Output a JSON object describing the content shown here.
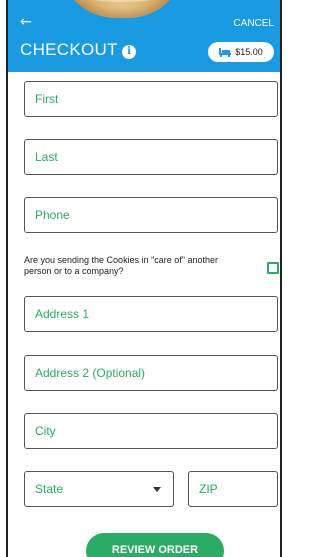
{
  "header": {
    "back_icon": "arrow-left-icon",
    "cancel_label": "CANCEL",
    "title": "CHECKOUT",
    "info_icon": "info-icon",
    "cart_icon": "cart-icon",
    "cart_total": "$15.00",
    "accent_color": "#1a9ae0"
  },
  "form": {
    "first_placeholder": "First",
    "last_placeholder": "Last",
    "phone_placeholder": "Phone",
    "care_of_question": "Are you sending the Cookies in \"care of\" another person or to a company?",
    "care_of_checked": false,
    "address1_placeholder": "Address 1",
    "address2_placeholder": "Address 2 (Optional)",
    "city_placeholder": "City",
    "state_placeholder": "State",
    "zip_placeholder": "ZIP",
    "field_text_color": "#2bab64"
  },
  "footer": {
    "review_label": "REVIEW ORDER",
    "button_color": "#2bab64"
  }
}
